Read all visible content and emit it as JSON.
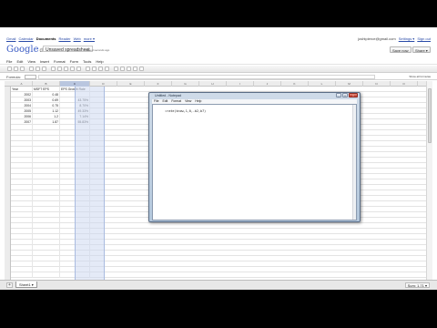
{
  "topbar": {
    "links": [
      "Gmail",
      "Calendar",
      "Documents",
      "Reader",
      "Web",
      "more ▾"
    ],
    "current": "Documents",
    "account": "joshtpierce@gmail.com",
    "settings": "Settings ▾",
    "signout": "Sign out"
  },
  "header": {
    "logo_brand": "Google",
    "logo_product": "docs",
    "doc_title": "Unsaved spreadsheet",
    "status": "Saved seconds ago",
    "save_now": "Save now",
    "share": "Share ▾"
  },
  "menus": [
    "File",
    "Edit",
    "View",
    "Insert",
    "Format",
    "Form",
    "Tools",
    "Help"
  ],
  "formula_bar": {
    "label": "Formula:",
    "cell": "C3",
    "show_all_formulas": "Show all formulas"
  },
  "columns": [
    "A",
    "B",
    "C",
    "D",
    "E",
    "F",
    "G",
    "H",
    "I",
    "J",
    "K",
    "L",
    "M",
    "N",
    "O"
  ],
  "selected_column": "C",
  "table": {
    "headers": [
      "Year",
      "MSFT EPS",
      "EPS Growth Rate"
    ],
    "rows": [
      {
        "year": "2002",
        "eps": "0.48",
        "growth": ""
      },
      {
        "year": "2003",
        "eps": "0.69",
        "growth": "43.75%"
      },
      {
        "year": "2004",
        "eps": "0.75",
        "growth": "8.70%"
      },
      {
        "year": "2005",
        "eps": "1.12",
        "growth": "49.33%"
      },
      {
        "year": "2006",
        "eps": "1.2",
        "growth": "7.14%"
      },
      {
        "year": "2007",
        "eps": "1.87",
        "growth": "55.83%"
      }
    ]
  },
  "sheet_tab": "Sheet1 ▾",
  "sum_display": "Sum: 1.71 ▾",
  "notepad": {
    "title": "Untitled - Notepad",
    "menus": [
      "File",
      "Edit",
      "Format",
      "View",
      "Help"
    ],
    "content": "=rate(know,1,0,-b2,b7)"
  }
}
